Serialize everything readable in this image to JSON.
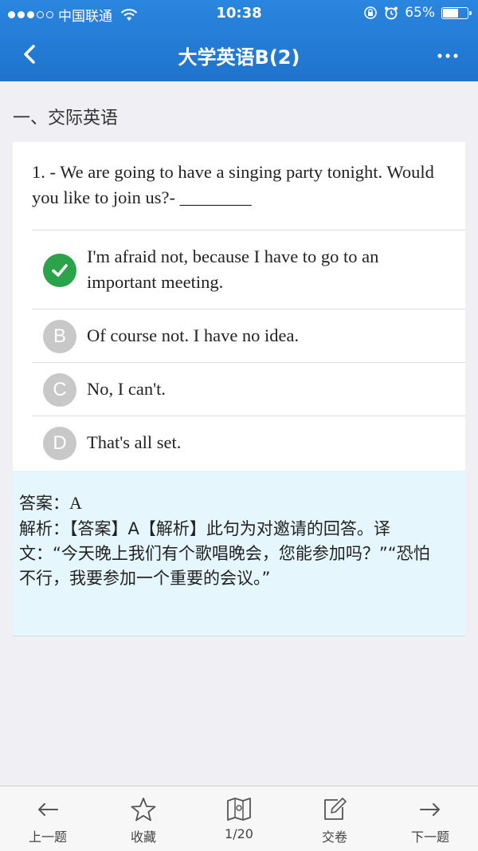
{
  "status_bar": {
    "carrier": "中国联通",
    "time": "10:38",
    "battery_text": "65%",
    "battery_level": 0.65
  },
  "nav": {
    "title": "大学英语B(2)",
    "back_icon": "chevron-left-icon",
    "more_icon": "more-dots-icon"
  },
  "section": {
    "title": "一、交际英语"
  },
  "question": {
    "text": "1. - We are going to have a singing party tonight. Would you like to join us?- ________",
    "options": [
      {
        "letter": "A",
        "text": "I'm afraid not, because I have to go to an important meeting.",
        "correct": true
      },
      {
        "letter": "B",
        "text": "Of course not. I have no idea.",
        "correct": false
      },
      {
        "letter": "C",
        "text": "No, I can't.",
        "correct": false
      },
      {
        "letter": "D",
        "text": "That's all set.",
        "correct": false
      }
    ]
  },
  "answer": {
    "label": "答案：",
    "value": "A",
    "analysis_label": "解析：",
    "analysis_text": "【答案】A【解析】此句为对邀请的回答。译文：“今天晚上我们有个歌唱晚会，您能参加吗？”“恐怕不行，我要参加一个重要的会议。”"
  },
  "tabbar": {
    "prev": "上一题",
    "favorite": "收藏",
    "progress": "1/20",
    "submit": "交卷",
    "next": "下一题"
  },
  "colors": {
    "header": "#1f73cd",
    "correct": "#2aa34a",
    "answer_bg": "#e6f6fd"
  }
}
